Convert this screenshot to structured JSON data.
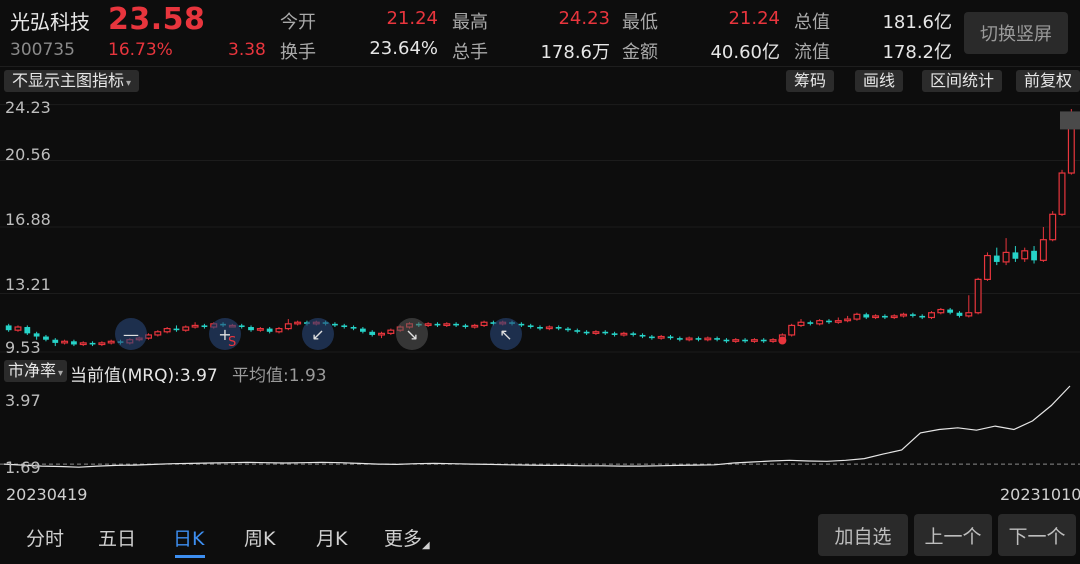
{
  "header": {
    "stock_name": "光弘科技",
    "price": "23.58",
    "code": "300735",
    "change_pct": "16.73%",
    "change": "3.38",
    "stats": [
      {
        "label": "今开",
        "value": "21.24",
        "color": "red"
      },
      {
        "label": "最高",
        "value": "24.23",
        "color": "red"
      },
      {
        "label": "最低",
        "value": "21.24",
        "color": "red"
      },
      {
        "label": "总值",
        "value": "181.6亿",
        "color": "white"
      },
      {
        "label": "换手",
        "value": "23.64%",
        "color": "white"
      },
      {
        "label": "总手",
        "value": "178.6万",
        "color": "white"
      },
      {
        "label": "金额",
        "value": "40.60亿",
        "color": "white"
      },
      {
        "label": "流值",
        "value": "178.2亿",
        "color": "white"
      }
    ],
    "switch_button": "切换竖屏"
  },
  "toolbar": {
    "indicator_selector": "不显示主图指标",
    "buttons": [
      "筹码",
      "画线",
      "区间统计",
      "前复权"
    ]
  },
  "main_chart": {
    "y_labels": [
      "24.23",
      "20.56",
      "16.88",
      "13.21",
      "9.53"
    ]
  },
  "sub_chart": {
    "indicator_selector": "市净率",
    "current_label": "当前值(MRQ):3.97",
    "avg_label": "平均值:1.93",
    "y_top": "3.97",
    "y_bottom": "1.69"
  },
  "dates": {
    "start": "20230419",
    "end": "20231010"
  },
  "bottom_nav": {
    "tabs": [
      "分时",
      "五日",
      "日K",
      "周K",
      "月K",
      "更多"
    ],
    "active_tab": "日K",
    "buttons": [
      "加自选",
      "上一个",
      "下一个"
    ]
  },
  "chart_data": {
    "type": "candlestick",
    "ylim": [
      8.8,
      24.8
    ],
    "candles": [
      [
        10.6,
        10.3,
        10.7,
        10.2
      ],
      [
        10.3,
        10.5,
        10.6,
        10.2
      ],
      [
        10.5,
        10.1,
        10.6,
        10.0
      ],
      [
        10.1,
        9.9,
        10.2,
        9.7
      ],
      [
        9.9,
        9.7,
        10.0,
        9.6
      ],
      [
        9.7,
        9.5,
        9.8,
        9.3
      ],
      [
        9.5,
        9.6,
        9.7,
        9.4
      ],
      [
        9.6,
        9.4,
        9.7,
        9.3
      ],
      [
        9.4,
        9.5,
        9.6,
        9.3
      ],
      [
        9.5,
        9.4,
        9.6,
        9.3
      ],
      [
        9.4,
        9.5,
        9.6,
        9.3
      ],
      [
        9.5,
        9.6,
        9.7,
        9.4
      ],
      [
        9.6,
        9.5,
        9.7,
        9.4
      ],
      [
        9.5,
        9.7,
        9.8,
        9.4
      ],
      [
        9.7,
        9.8,
        9.9,
        9.6
      ],
      [
        9.8,
        10.0,
        10.1,
        9.7
      ],
      [
        10.0,
        10.2,
        10.3,
        9.9
      ],
      [
        10.2,
        10.4,
        10.5,
        10.1
      ],
      [
        10.4,
        10.3,
        10.6,
        10.2
      ],
      [
        10.3,
        10.5,
        10.6,
        10.2
      ],
      [
        10.5,
        10.6,
        10.8,
        10.4
      ],
      [
        10.6,
        10.5,
        10.7,
        10.4
      ],
      [
        10.5,
        10.7,
        10.8,
        10.4
      ],
      [
        10.7,
        10.6,
        10.8,
        10.5
      ],
      [
        10.6,
        10.6,
        10.7,
        10.5
      ],
      [
        10.6,
        10.5,
        10.7,
        10.4
      ],
      [
        10.5,
        10.3,
        10.6,
        10.2
      ],
      [
        10.3,
        10.4,
        10.5,
        10.2
      ],
      [
        10.4,
        10.2,
        10.5,
        10.1
      ],
      [
        10.2,
        10.4,
        10.5,
        10.1
      ],
      [
        10.4,
        10.7,
        11.0,
        10.3
      ],
      [
        10.7,
        10.8,
        10.9,
        10.6
      ],
      [
        10.8,
        10.7,
        10.9,
        10.6
      ],
      [
        10.7,
        10.8,
        10.9,
        10.6
      ],
      [
        10.8,
        10.7,
        10.9,
        10.6
      ],
      [
        10.7,
        10.6,
        10.8,
        10.5
      ],
      [
        10.6,
        10.5,
        10.7,
        10.4
      ],
      [
        10.5,
        10.4,
        10.6,
        10.3
      ],
      [
        10.4,
        10.2,
        10.5,
        10.1
      ],
      [
        10.2,
        10.0,
        10.3,
        9.9
      ],
      [
        10.0,
        10.1,
        10.2,
        9.8
      ],
      [
        10.1,
        10.3,
        10.4,
        10.0
      ],
      [
        10.3,
        10.5,
        10.6,
        10.2
      ],
      [
        10.5,
        10.7,
        10.8,
        10.4
      ],
      [
        10.7,
        10.6,
        10.8,
        10.5
      ],
      [
        10.6,
        10.7,
        10.8,
        10.5
      ],
      [
        10.7,
        10.6,
        10.8,
        10.5
      ],
      [
        10.6,
        10.7,
        10.8,
        10.5
      ],
      [
        10.7,
        10.6,
        10.8,
        10.5
      ],
      [
        10.6,
        10.5,
        10.7,
        10.4
      ],
      [
        10.5,
        10.6,
        10.7,
        10.4
      ],
      [
        10.6,
        10.8,
        10.9,
        10.5
      ],
      [
        10.8,
        10.7,
        10.9,
        10.6
      ],
      [
        10.7,
        10.8,
        10.9,
        10.6
      ],
      [
        10.8,
        10.7,
        10.9,
        10.6
      ],
      [
        10.7,
        10.6,
        10.8,
        10.5
      ],
      [
        10.6,
        10.5,
        10.7,
        10.4
      ],
      [
        10.5,
        10.4,
        10.6,
        10.3
      ],
      [
        10.4,
        10.5,
        10.6,
        10.3
      ],
      [
        10.5,
        10.4,
        10.6,
        10.3
      ],
      [
        10.4,
        10.3,
        10.5,
        10.2
      ],
      [
        10.3,
        10.2,
        10.4,
        10.1
      ],
      [
        10.2,
        10.1,
        10.3,
        10.0
      ],
      [
        10.1,
        10.2,
        10.3,
        10.0
      ],
      [
        10.2,
        10.1,
        10.3,
        10.0
      ],
      [
        10.1,
        10.0,
        10.2,
        9.9
      ],
      [
        10.0,
        10.1,
        10.2,
        9.9
      ],
      [
        10.1,
        10.0,
        10.2,
        9.9
      ],
      [
        10.0,
        9.9,
        10.1,
        9.8
      ],
      [
        9.9,
        9.8,
        10.0,
        9.7
      ],
      [
        9.8,
        9.9,
        10.0,
        9.7
      ],
      [
        9.9,
        9.8,
        10.0,
        9.7
      ],
      [
        9.8,
        9.7,
        9.9,
        9.6
      ],
      [
        9.7,
        9.8,
        9.9,
        9.6
      ],
      [
        9.8,
        9.7,
        9.9,
        9.6
      ],
      [
        9.7,
        9.8,
        9.9,
        9.6
      ],
      [
        9.8,
        9.7,
        9.9,
        9.6
      ],
      [
        9.7,
        9.6,
        9.8,
        9.5
      ],
      [
        9.6,
        9.7,
        9.8,
        9.5
      ],
      [
        9.7,
        9.6,
        9.8,
        9.5
      ],
      [
        9.6,
        9.7,
        9.8,
        9.5
      ],
      [
        9.7,
        9.6,
        9.8,
        9.5
      ],
      [
        9.6,
        9.7,
        9.8,
        9.5
      ],
      [
        9.7,
        10.0,
        10.1,
        9.6
      ],
      [
        10.0,
        10.6,
        10.7,
        9.9
      ],
      [
        10.6,
        10.8,
        11.0,
        10.5
      ],
      [
        10.8,
        10.7,
        10.9,
        10.6
      ],
      [
        10.7,
        10.9,
        11.0,
        10.6
      ],
      [
        10.9,
        10.8,
        11.0,
        10.7
      ],
      [
        10.8,
        10.9,
        11.1,
        10.7
      ],
      [
        10.9,
        11.0,
        11.2,
        10.8
      ],
      [
        11.0,
        11.3,
        11.4,
        10.9
      ],
      [
        11.3,
        11.1,
        11.4,
        11.0
      ],
      [
        11.1,
        11.2,
        11.3,
        11.0
      ],
      [
        11.2,
        11.1,
        11.3,
        11.0
      ],
      [
        11.1,
        11.2,
        11.3,
        11.0
      ],
      [
        11.2,
        11.3,
        11.4,
        11.1
      ],
      [
        11.3,
        11.2,
        11.4,
        11.1
      ],
      [
        11.2,
        11.1,
        11.3,
        11.0
      ],
      [
        11.1,
        11.4,
        11.5,
        11.0
      ],
      [
        11.4,
        11.6,
        11.7,
        11.3
      ],
      [
        11.6,
        11.4,
        11.7,
        11.3
      ],
      [
        11.4,
        11.2,
        11.5,
        11.1
      ],
      [
        11.2,
        11.4,
        12.5,
        11.1
      ],
      [
        11.4,
        13.5,
        13.6,
        11.3
      ],
      [
        13.5,
        15.0,
        15.2,
        13.4
      ],
      [
        15.0,
        14.6,
        15.5,
        14.4
      ],
      [
        14.6,
        15.2,
        16.1,
        14.4
      ],
      [
        15.2,
        14.8,
        15.6,
        14.6
      ],
      [
        14.8,
        15.3,
        15.5,
        14.6
      ],
      [
        15.3,
        14.7,
        15.6,
        14.5
      ],
      [
        14.7,
        16.0,
        16.8,
        14.6
      ],
      [
        16.0,
        17.6,
        17.8,
        15.9
      ],
      [
        17.6,
        20.2,
        20.4,
        17.5
      ],
      [
        20.2,
        23.58,
        24.23,
        20.1
      ]
    ]
  },
  "pb_chart": {
    "ylim": [
      1.4,
      3.97
    ],
    "avg": 1.69,
    "values": [
      1.69,
      1.66,
      1.63,
      1.62,
      1.6,
      1.63,
      1.65,
      1.66,
      1.68,
      1.7,
      1.71,
      1.72,
      1.73,
      1.74,
      1.73,
      1.72,
      1.73,
      1.74,
      1.73,
      1.71,
      1.69,
      1.68,
      1.7,
      1.71,
      1.7,
      1.69,
      1.68,
      1.67,
      1.66,
      1.65,
      1.65,
      1.64,
      1.64,
      1.63,
      1.63,
      1.64,
      1.65,
      1.66,
      1.67,
      1.72,
      1.75,
      1.78,
      1.8,
      1.78,
      1.77,
      1.8,
      1.85,
      1.98,
      2.1,
      2.6,
      2.7,
      2.75,
      2.68,
      2.8,
      2.7,
      2.95,
      3.4,
      3.97
    ]
  }
}
